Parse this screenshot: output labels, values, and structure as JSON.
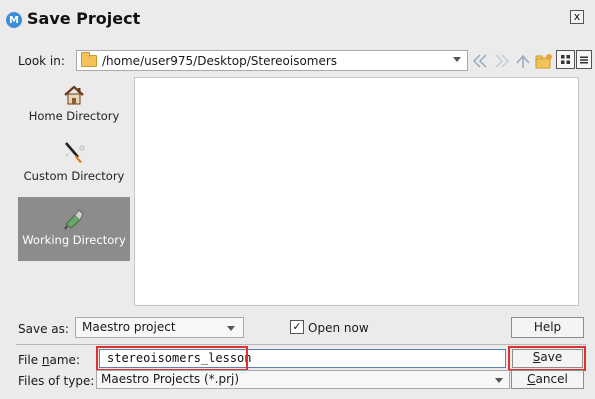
{
  "window": {
    "title": "Save Project",
    "app_icon_letter": "M",
    "close_glyph": "x"
  },
  "lookin": {
    "label": "Look in:",
    "path": "/home/user975/Desktop/Stereoisomers"
  },
  "sidebar": {
    "items": [
      {
        "label": "Home Directory",
        "icon": "home-icon",
        "active": false
      },
      {
        "label": "Custom Directory",
        "icon": "custom-directory-icon",
        "active": false
      },
      {
        "label": "Working Directory",
        "icon": "working-directory-icon",
        "active": true
      }
    ]
  },
  "saveas": {
    "label": "Save as:",
    "value": "Maestro project"
  },
  "open_now": {
    "checked": true,
    "check_glyph": "✓",
    "label": "Open now"
  },
  "buttons": {
    "help": "Help",
    "save_underline": "S",
    "save_rest": "ave",
    "cancel_underline": "C",
    "cancel_rest": "ancel"
  },
  "filename": {
    "label_pre": "File ",
    "label_underline": "n",
    "label_post": "ame:",
    "value": "stereoisomers_lesson"
  },
  "filetype": {
    "label": "Files of type:",
    "value": "Maestro Projects (*.prj)"
  },
  "colors": {
    "highlight": "#e03030",
    "active_sidebar": "#8c8c8c",
    "app_icon": "#3c8fd6"
  }
}
